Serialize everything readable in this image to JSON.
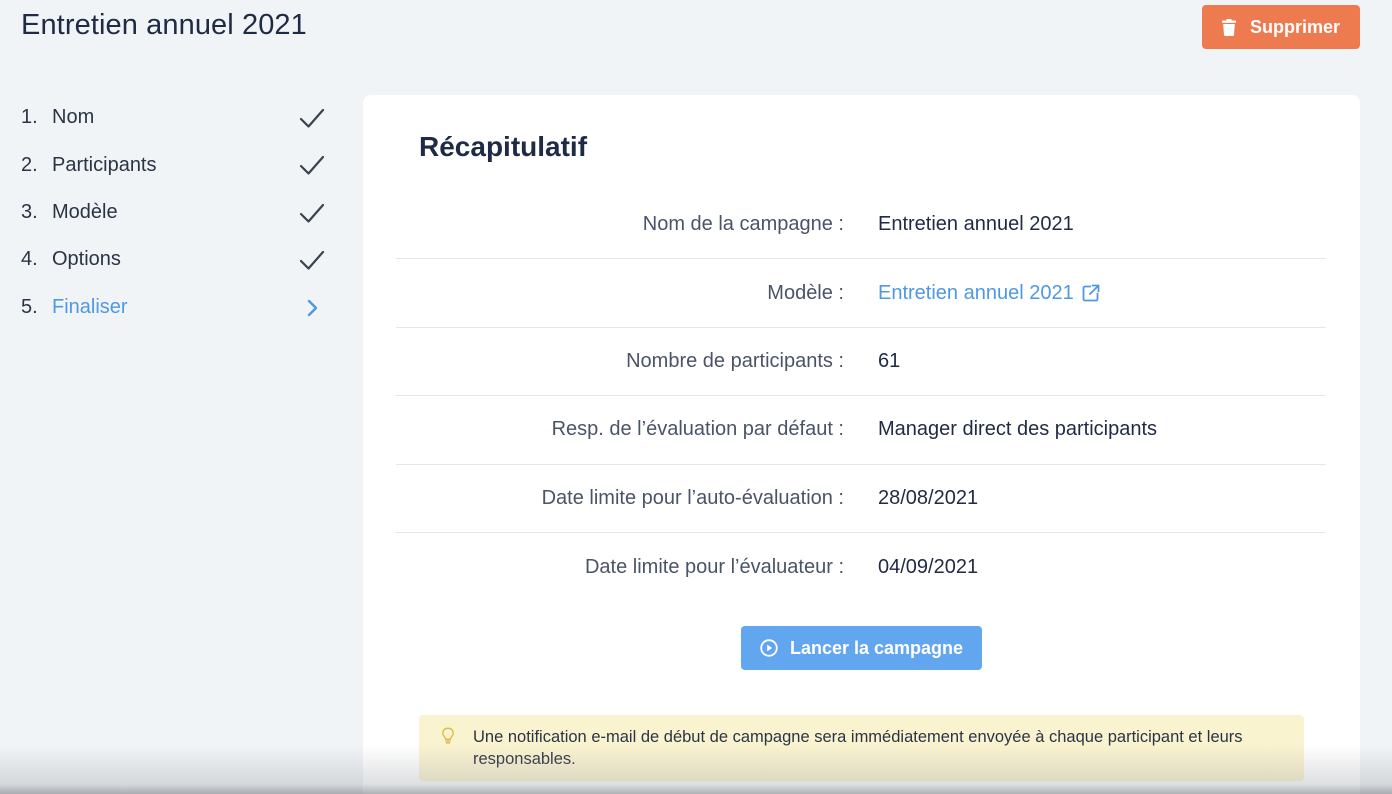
{
  "header": {
    "title": "Entretien annuel 2021",
    "delete_label": "Supprimer"
  },
  "steps": [
    {
      "number": "1.",
      "label": "Nom",
      "status": "done"
    },
    {
      "number": "2.",
      "label": "Participants",
      "status": "done"
    },
    {
      "number": "3.",
      "label": "Modèle",
      "status": "done"
    },
    {
      "number": "4.",
      "label": "Options",
      "status": "done"
    },
    {
      "number": "5.",
      "label": "Finaliser",
      "status": "current"
    }
  ],
  "summary": {
    "title": "Récapitulatif",
    "rows": [
      {
        "label": "Nom de la campagne :",
        "value": "Entretien annuel 2021"
      },
      {
        "label": "Modèle :",
        "value": "Entretien annuel 2021"
      },
      {
        "label": "Nombre de participants :",
        "value": "61"
      },
      {
        "label": "Resp. de l’évaluation par défaut :",
        "value": "Manager direct des participants"
      },
      {
        "label": "Date limite pour l’auto-évaluation :",
        "value": "28/08/2021"
      },
      {
        "label": "Date limite pour l’évaluateur :",
        "value": "04/09/2021"
      }
    ],
    "launch_label": "Lancer la campagne",
    "notice": "Une notification e-mail de début de campagne sera immédiatement envoyée à chaque participant et leurs responsables."
  },
  "colors": {
    "accent": "#4f98e4",
    "delete": "#ee7a50",
    "launch": "#62a6f0",
    "notice_bg": "#faf3cf",
    "page_bg": "#f1f4f6"
  },
  "icons": {
    "delete": "trash-icon",
    "done": "check-icon",
    "current": "chevron-right-icon",
    "model_link": "external-link-icon",
    "launch": "play-circle-icon",
    "notice": "lightbulb-icon"
  }
}
